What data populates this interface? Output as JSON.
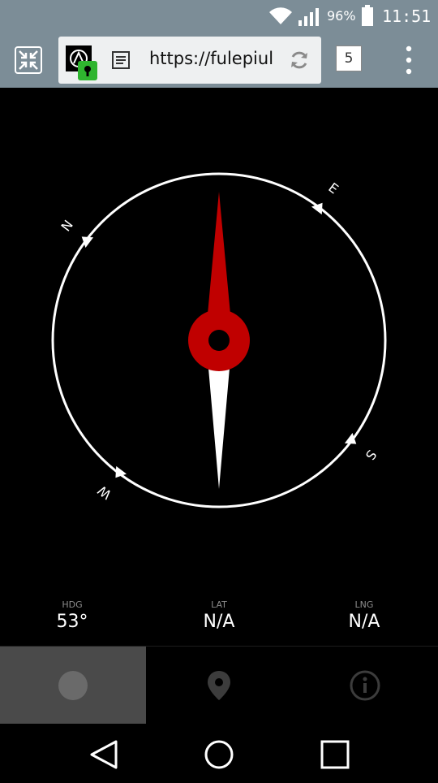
{
  "status_bar": {
    "battery_percent": "96%",
    "time": "11:51",
    "icons": [
      "wifi-icon",
      "signal-icon",
      "battery-icon"
    ]
  },
  "browser": {
    "url": "https://fulepiul",
    "tab_count": "5",
    "icons": [
      "exit-fullscreen-icon",
      "site-icon",
      "lock-icon",
      "reader-mode-icon",
      "reload-icon",
      "tabs-icon",
      "more-vert-icon"
    ]
  },
  "compass": {
    "labels": {
      "north": "N",
      "east": "E",
      "south": "S",
      "west": "W"
    },
    "heading_degrees": 53,
    "colors": {
      "needle_north": "#c00000",
      "needle_south": "#ffffff",
      "ring": "#ffffff"
    }
  },
  "info": {
    "hdg": {
      "label": "HDG",
      "value": "53°"
    },
    "lat": {
      "label": "LAT",
      "value": "N/A"
    },
    "lng": {
      "label": "LNG",
      "value": "N/A"
    }
  },
  "bottom_tabs": [
    {
      "icon": "circle-icon",
      "selected": true
    },
    {
      "icon": "location-pin-icon",
      "selected": false
    },
    {
      "icon": "info-icon",
      "selected": false
    }
  ],
  "nav_bar": {
    "icons": [
      "back-icon",
      "home-icon",
      "recents-icon"
    ]
  }
}
